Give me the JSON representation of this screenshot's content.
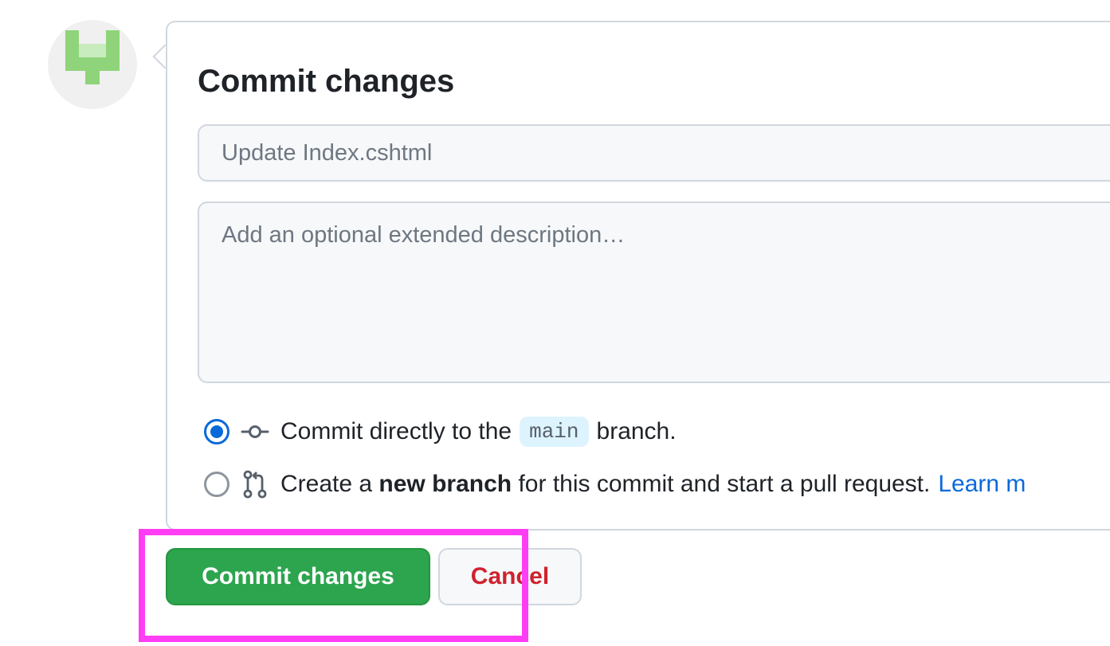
{
  "avatar": {
    "alt": "user identicon"
  },
  "commit_form": {
    "title": "Commit changes",
    "summary_placeholder": "Update Index.cshtml",
    "description_placeholder": "Add an optional extended description…",
    "options": {
      "direct": {
        "selected": true,
        "prefix": "Commit directly to the",
        "branch": "main",
        "suffix": "branch."
      },
      "new_branch": {
        "selected": false,
        "prefix": "Create a",
        "bold": "new branch",
        "suffix": "for this commit and start a pull request.",
        "link": "Learn m"
      }
    }
  },
  "buttons": {
    "commit_label": "Commit changes",
    "cancel_label": "Cancel"
  },
  "colors": {
    "commit_button": "#2da44e",
    "cancel_text": "#cf222e",
    "link": "#0969da",
    "highlight": "#ff3df5",
    "identicon": "#8fd47a"
  },
  "icons": {
    "direct_commit": "git-commit-icon",
    "new_branch": "git-pull-request-icon"
  }
}
